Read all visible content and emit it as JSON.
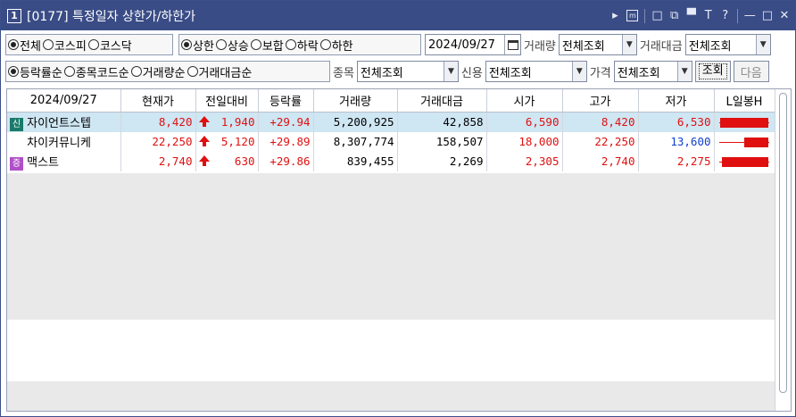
{
  "window": {
    "number": "1",
    "title": "[0177] 특정일자 상한가/하한가",
    "controls": [
      "▸",
      "m",
      "□",
      "⧉",
      "▀",
      "T",
      "?",
      "—",
      "□",
      "✕"
    ]
  },
  "market_filter": {
    "options": [
      {
        "label": "전체",
        "selected": true
      },
      {
        "label": "코스피",
        "selected": false
      },
      {
        "label": "코스닥",
        "selected": false
      }
    ]
  },
  "limit_filter": {
    "options": [
      {
        "label": "상한",
        "selected": true
      },
      {
        "label": "상승",
        "selected": false
      },
      {
        "label": "보합",
        "selected": false
      },
      {
        "label": "하락",
        "selected": false
      },
      {
        "label": "하한",
        "selected": false
      }
    ]
  },
  "date_value": "2024/09/27",
  "volume_label": "거래량",
  "volume_value": "전체조회",
  "amount_label": "거래대금",
  "amount_value": "전체조회",
  "sort_filter": {
    "options": [
      {
        "label": "등락률순",
        "selected": true
      },
      {
        "label": "종목코드순",
        "selected": false
      },
      {
        "label": "거래량순",
        "selected": false
      },
      {
        "label": "거래대금순",
        "selected": false
      }
    ]
  },
  "stock_label": "종목",
  "stock_value": "전체조회",
  "credit_label": "신용",
  "credit_value": "전체조회",
  "price_label": "가격",
  "price_value": "전체조회",
  "search_button": "조회",
  "next_button": "다음",
  "table": {
    "headers": [
      "2024/09/27",
      "현재가",
      "전일대비",
      "등락률",
      "거래량",
      "거래대금",
      "시가",
      "고가",
      "저가",
      "L일봉H"
    ],
    "rows": [
      {
        "badge": "신",
        "badge_color": "#1a7a6a",
        "name": "자이언트스텝",
        "price": "8,420",
        "change": "1,940",
        "rate": "+29.94",
        "volume": "5,200,925",
        "amount": "42,858",
        "open": "6,590",
        "high": "8,420",
        "low": "6,530",
        "low_color": "red",
        "selected": true,
        "candle": {
          "open": 6590,
          "close": 8420,
          "low": 6530,
          "high": 8420
        }
      },
      {
        "badge": "",
        "badge_color": "",
        "name": "차이커뮤니케",
        "price": "22,250",
        "change": "5,120",
        "rate": "+29.89",
        "volume": "8,307,774",
        "amount": "158,507",
        "open": "18,000",
        "high": "22,250",
        "low": "13,600",
        "low_color": "blue",
        "selected": false,
        "candle": {
          "open": 18000,
          "close": 22250,
          "low": 13600,
          "high": 22250
        }
      },
      {
        "badge": "증",
        "badge_color": "#b050c8",
        "name": "맥스트",
        "price": "2,740",
        "change": "630",
        "rate": "+29.86",
        "volume": "839,455",
        "amount": "2,269",
        "open": "2,305",
        "high": "2,740",
        "low": "2,275",
        "low_color": "red",
        "selected": false,
        "candle": {
          "open": 2305,
          "close": 2740,
          "low": 2275,
          "high": 2740
        }
      }
    ]
  }
}
